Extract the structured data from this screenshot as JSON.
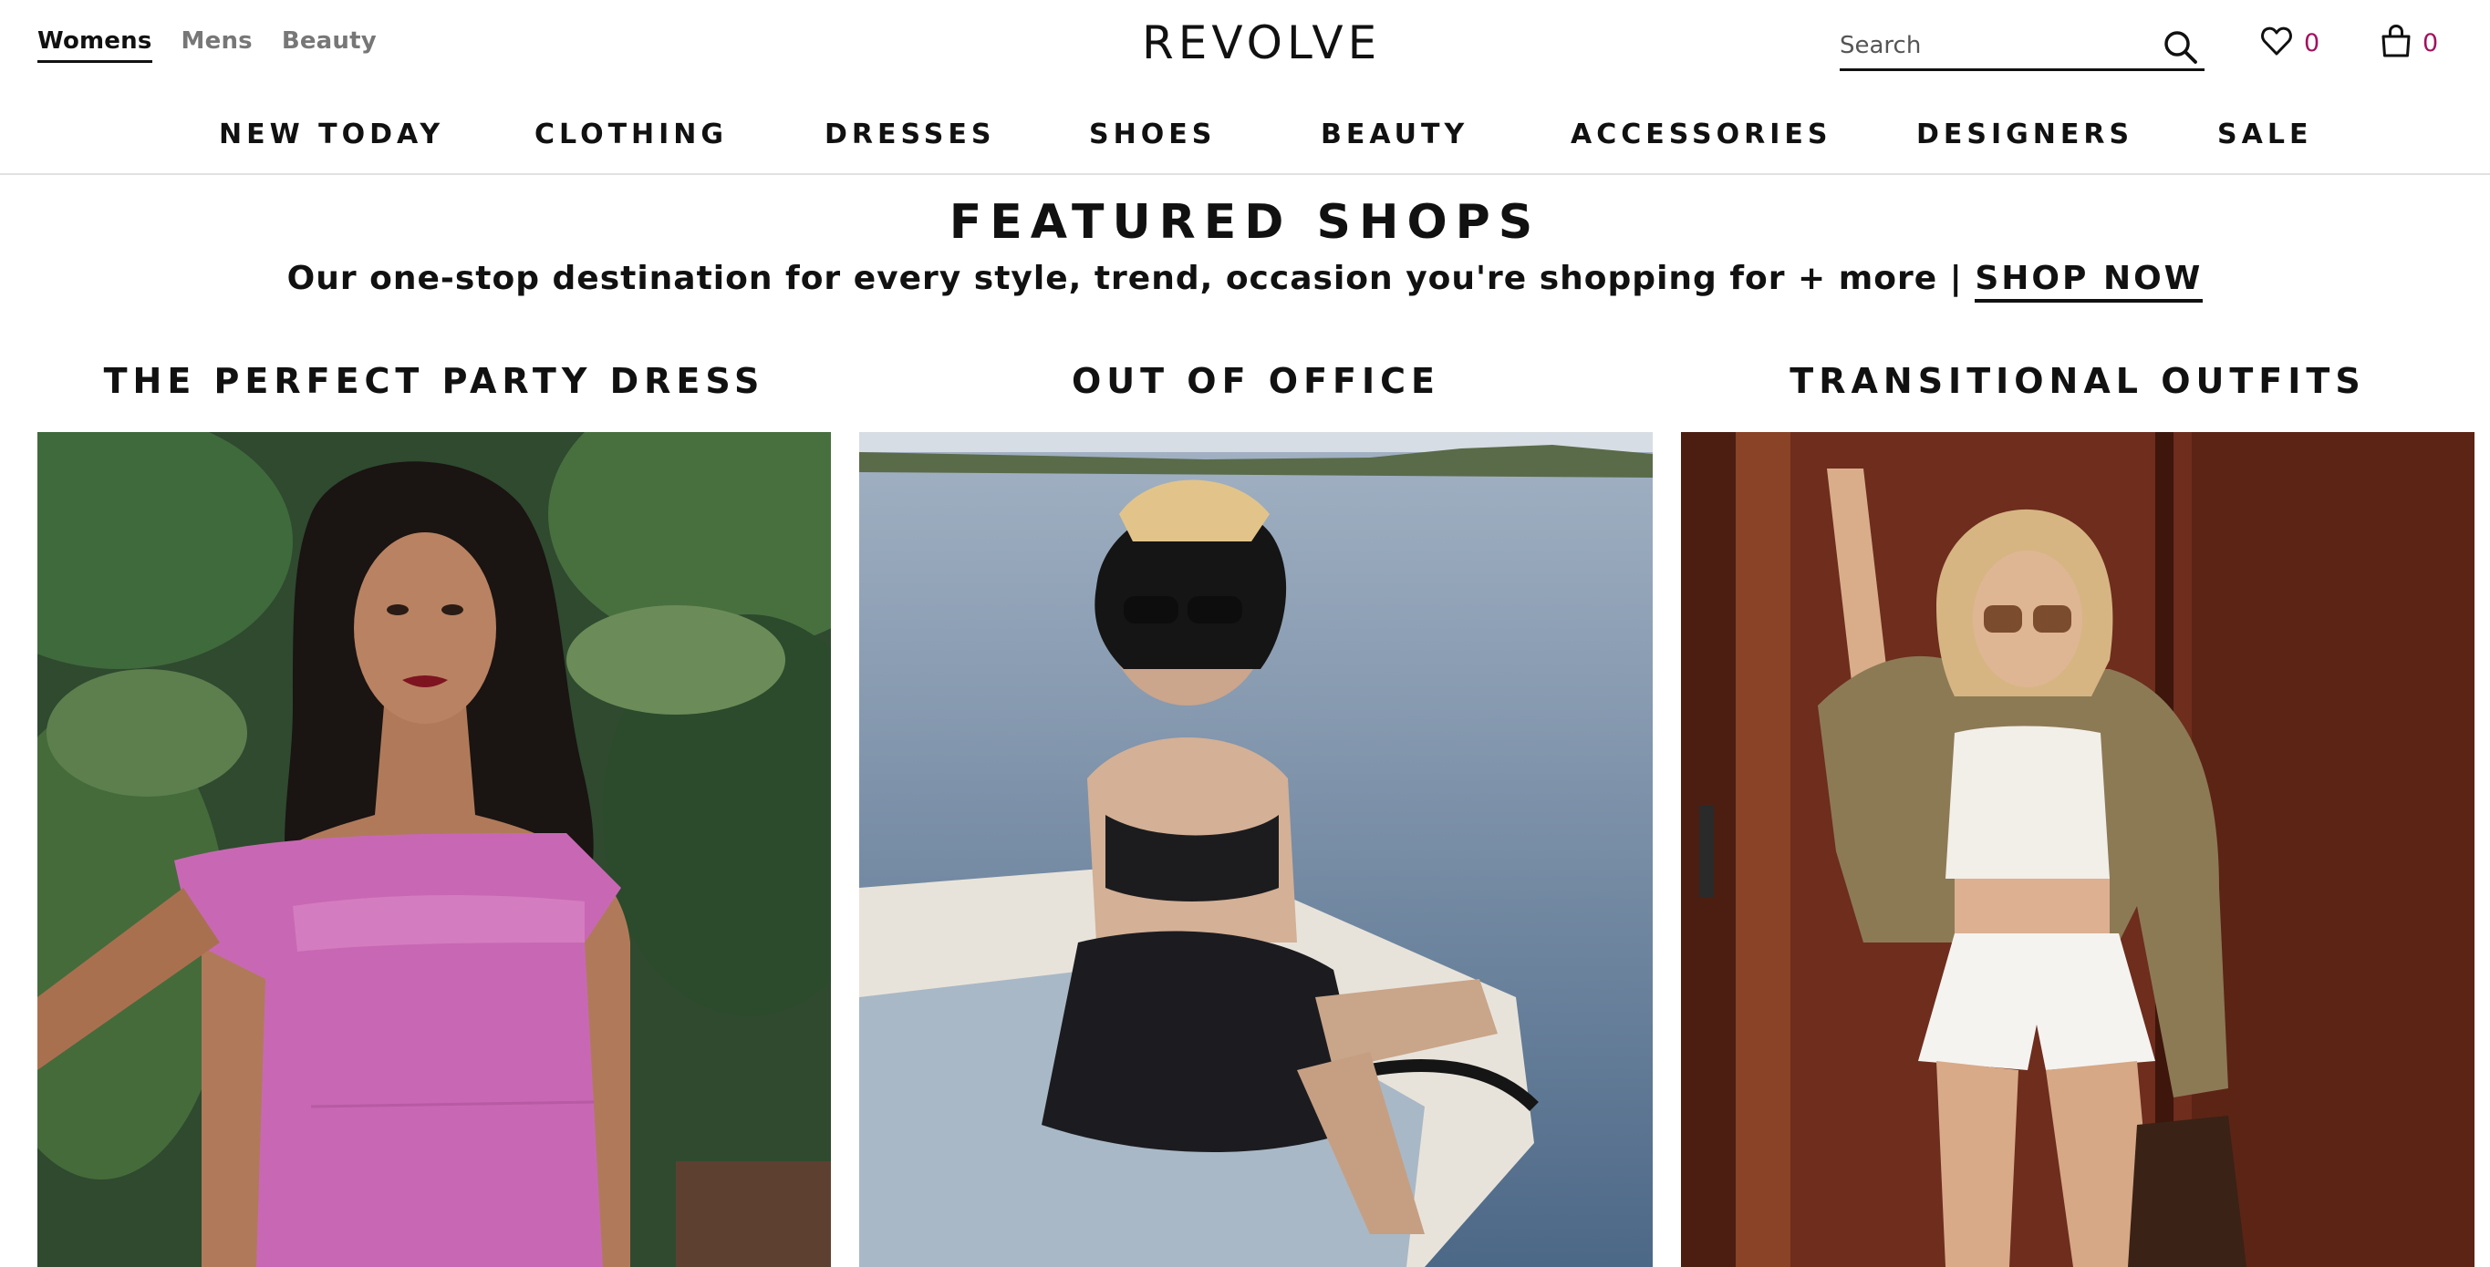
{
  "header": {
    "gender_tabs": [
      {
        "label": "Womens",
        "active": true
      },
      {
        "label": "Mens",
        "active": false
      },
      {
        "label": "Beauty",
        "active": false
      }
    ],
    "logo": "REVOLVE",
    "search": {
      "placeholder": "Search",
      "value": "",
      "icon": "search-icon"
    },
    "favorites": {
      "icon": "heart-icon",
      "count": "0"
    },
    "bag": {
      "icon": "shopping-bag-icon",
      "count": "0"
    },
    "accent_color": "#a3125f"
  },
  "nav": {
    "items": [
      "NEW TODAY",
      "CLOTHING",
      "DRESSES",
      "SHOES",
      "BEAUTY",
      "ACCESSORIES",
      "DESIGNERS",
      "SALE"
    ]
  },
  "featured": {
    "title": "FEATURED SHOPS",
    "subtitle": "Our one-stop destination for every style, trend, occasion you're shopping for + more |",
    "cta": "SHOP NOW"
  },
  "shops": [
    {
      "title": "THE PERFECT PARTY DRESS"
    },
    {
      "title": "OUT OF OFFICE"
    },
    {
      "title": "TRANSITIONAL OUTFITS"
    }
  ]
}
